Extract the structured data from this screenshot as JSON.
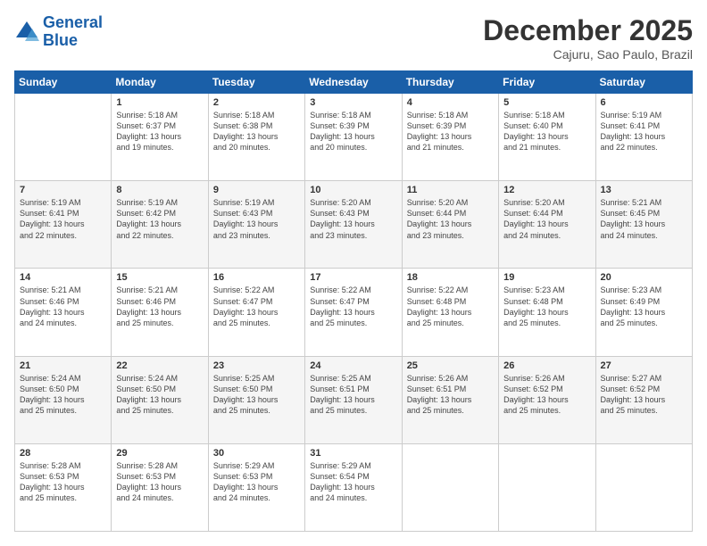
{
  "header": {
    "logo_line1": "General",
    "logo_line2": "Blue",
    "month": "December 2025",
    "location": "Cajuru, Sao Paulo, Brazil"
  },
  "weekdays": [
    "Sunday",
    "Monday",
    "Tuesday",
    "Wednesday",
    "Thursday",
    "Friday",
    "Saturday"
  ],
  "weeks": [
    [
      {
        "day": "",
        "info": ""
      },
      {
        "day": "1",
        "info": "Sunrise: 5:18 AM\nSunset: 6:37 PM\nDaylight: 13 hours\nand 19 minutes."
      },
      {
        "day": "2",
        "info": "Sunrise: 5:18 AM\nSunset: 6:38 PM\nDaylight: 13 hours\nand 20 minutes."
      },
      {
        "day": "3",
        "info": "Sunrise: 5:18 AM\nSunset: 6:39 PM\nDaylight: 13 hours\nand 20 minutes."
      },
      {
        "day": "4",
        "info": "Sunrise: 5:18 AM\nSunset: 6:39 PM\nDaylight: 13 hours\nand 21 minutes."
      },
      {
        "day": "5",
        "info": "Sunrise: 5:18 AM\nSunset: 6:40 PM\nDaylight: 13 hours\nand 21 minutes."
      },
      {
        "day": "6",
        "info": "Sunrise: 5:19 AM\nSunset: 6:41 PM\nDaylight: 13 hours\nand 22 minutes."
      }
    ],
    [
      {
        "day": "7",
        "info": "Sunrise: 5:19 AM\nSunset: 6:41 PM\nDaylight: 13 hours\nand 22 minutes."
      },
      {
        "day": "8",
        "info": "Sunrise: 5:19 AM\nSunset: 6:42 PM\nDaylight: 13 hours\nand 22 minutes."
      },
      {
        "day": "9",
        "info": "Sunrise: 5:19 AM\nSunset: 6:43 PM\nDaylight: 13 hours\nand 23 minutes."
      },
      {
        "day": "10",
        "info": "Sunrise: 5:20 AM\nSunset: 6:43 PM\nDaylight: 13 hours\nand 23 minutes."
      },
      {
        "day": "11",
        "info": "Sunrise: 5:20 AM\nSunset: 6:44 PM\nDaylight: 13 hours\nand 23 minutes."
      },
      {
        "day": "12",
        "info": "Sunrise: 5:20 AM\nSunset: 6:44 PM\nDaylight: 13 hours\nand 24 minutes."
      },
      {
        "day": "13",
        "info": "Sunrise: 5:21 AM\nSunset: 6:45 PM\nDaylight: 13 hours\nand 24 minutes."
      }
    ],
    [
      {
        "day": "14",
        "info": "Sunrise: 5:21 AM\nSunset: 6:46 PM\nDaylight: 13 hours\nand 24 minutes."
      },
      {
        "day": "15",
        "info": "Sunrise: 5:21 AM\nSunset: 6:46 PM\nDaylight: 13 hours\nand 25 minutes."
      },
      {
        "day": "16",
        "info": "Sunrise: 5:22 AM\nSunset: 6:47 PM\nDaylight: 13 hours\nand 25 minutes."
      },
      {
        "day": "17",
        "info": "Sunrise: 5:22 AM\nSunset: 6:47 PM\nDaylight: 13 hours\nand 25 minutes."
      },
      {
        "day": "18",
        "info": "Sunrise: 5:22 AM\nSunset: 6:48 PM\nDaylight: 13 hours\nand 25 minutes."
      },
      {
        "day": "19",
        "info": "Sunrise: 5:23 AM\nSunset: 6:48 PM\nDaylight: 13 hours\nand 25 minutes."
      },
      {
        "day": "20",
        "info": "Sunrise: 5:23 AM\nSunset: 6:49 PM\nDaylight: 13 hours\nand 25 minutes."
      }
    ],
    [
      {
        "day": "21",
        "info": "Sunrise: 5:24 AM\nSunset: 6:50 PM\nDaylight: 13 hours\nand 25 minutes."
      },
      {
        "day": "22",
        "info": "Sunrise: 5:24 AM\nSunset: 6:50 PM\nDaylight: 13 hours\nand 25 minutes."
      },
      {
        "day": "23",
        "info": "Sunrise: 5:25 AM\nSunset: 6:50 PM\nDaylight: 13 hours\nand 25 minutes."
      },
      {
        "day": "24",
        "info": "Sunrise: 5:25 AM\nSunset: 6:51 PM\nDaylight: 13 hours\nand 25 minutes."
      },
      {
        "day": "25",
        "info": "Sunrise: 5:26 AM\nSunset: 6:51 PM\nDaylight: 13 hours\nand 25 minutes."
      },
      {
        "day": "26",
        "info": "Sunrise: 5:26 AM\nSunset: 6:52 PM\nDaylight: 13 hours\nand 25 minutes."
      },
      {
        "day": "27",
        "info": "Sunrise: 5:27 AM\nSunset: 6:52 PM\nDaylight: 13 hours\nand 25 minutes."
      }
    ],
    [
      {
        "day": "28",
        "info": "Sunrise: 5:28 AM\nSunset: 6:53 PM\nDaylight: 13 hours\nand 25 minutes."
      },
      {
        "day": "29",
        "info": "Sunrise: 5:28 AM\nSunset: 6:53 PM\nDaylight: 13 hours\nand 24 minutes."
      },
      {
        "day": "30",
        "info": "Sunrise: 5:29 AM\nSunset: 6:53 PM\nDaylight: 13 hours\nand 24 minutes."
      },
      {
        "day": "31",
        "info": "Sunrise: 5:29 AM\nSunset: 6:54 PM\nDaylight: 13 hours\nand 24 minutes."
      },
      {
        "day": "",
        "info": ""
      },
      {
        "day": "",
        "info": ""
      },
      {
        "day": "",
        "info": ""
      }
    ]
  ]
}
